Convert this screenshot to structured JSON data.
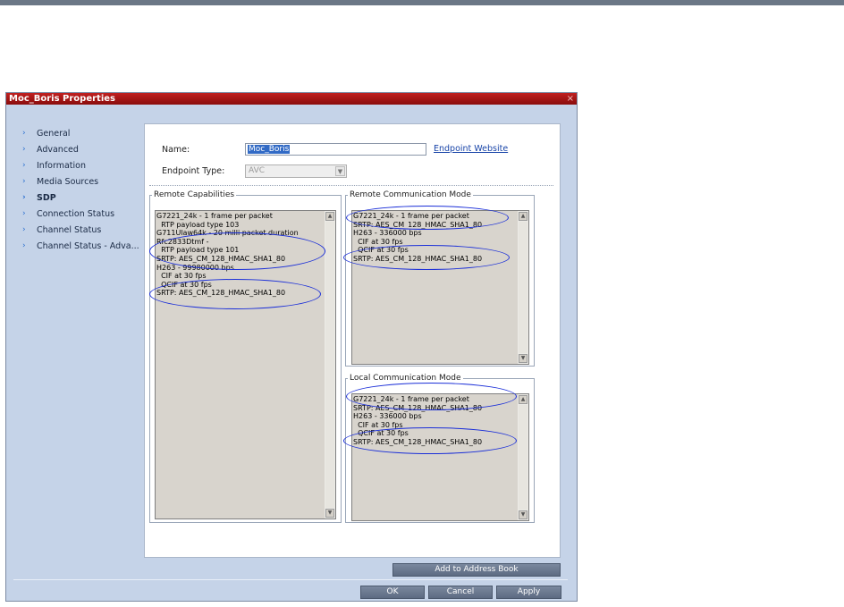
{
  "window": {
    "title": "Moc_Boris Properties",
    "close_glyph": "×"
  },
  "nav": {
    "items": [
      {
        "label": "General",
        "active": false
      },
      {
        "label": "Advanced",
        "active": false
      },
      {
        "label": "Information",
        "active": false
      },
      {
        "label": "Media Sources",
        "active": false
      },
      {
        "label": "SDP",
        "active": true
      },
      {
        "label": "Connection Status",
        "active": false
      },
      {
        "label": "Channel Status",
        "active": false
      },
      {
        "label": "Channel Status - Adva...",
        "active": false
      }
    ],
    "arrow_icon": "chevron-right-icon"
  },
  "form": {
    "name_label": "Name:",
    "name_value": "Moc_Boris",
    "endpoint_link": "Endpoint Website",
    "endpoint_type_label": "Endpoint Type:",
    "endpoint_type_value": "AVC"
  },
  "remote_capabilities": {
    "title": "Remote Capabilities",
    "lines": [
      "G7221_24k - 1 frame per packet",
      "  RTP payload type 103",
      "G711Ulaw64k - 20 milli packet duration",
      "Rfc2833Dtmf -",
      "  RTP payload type 101",
      "SRTP: AES_CM_128_HMAC_SHA1_80",
      "H263 - 99980000 bps",
      "  CIF at 30 fps",
      "  QCIF at 30 fps",
      "SRTP: AES_CM_128_HMAC_SHA1_80"
    ]
  },
  "remote_comm_mode": {
    "title": "Remote Communication Mode",
    "lines": [
      "G7221_24k - 1 frame per packet",
      "SRTP: AES_CM_128_HMAC_SHA1_80",
      "H263 - 336000 bps",
      "  CIF at 30 fps",
      "  QCIF at 30 fps",
      "SRTP: AES_CM_128_HMAC_SHA1_80"
    ]
  },
  "local_comm_mode": {
    "title": "Local Communication Mode",
    "lines": [
      "G7221_24k - 1 frame per packet",
      "SRTP: AES_CM_128_HMAC_SHA1_80",
      "H263 - 336000 bps",
      "  CIF at 30 fps",
      "  QCIF at 30 fps",
      "SRTP: AES_CM_128_HMAC_SHA1_80"
    ]
  },
  "scroll": {
    "up_glyph": "▲",
    "down_glyph": "▼",
    "dropdown_glyph": "▼"
  },
  "buttons": {
    "add_to_address_book": "Add to Address Book",
    "ok": "OK",
    "cancel": "Cancel",
    "apply": "Apply"
  },
  "colors": {
    "title_bar": "#b01818",
    "annotation": "#1a2ed8",
    "button": "#6a778d"
  }
}
